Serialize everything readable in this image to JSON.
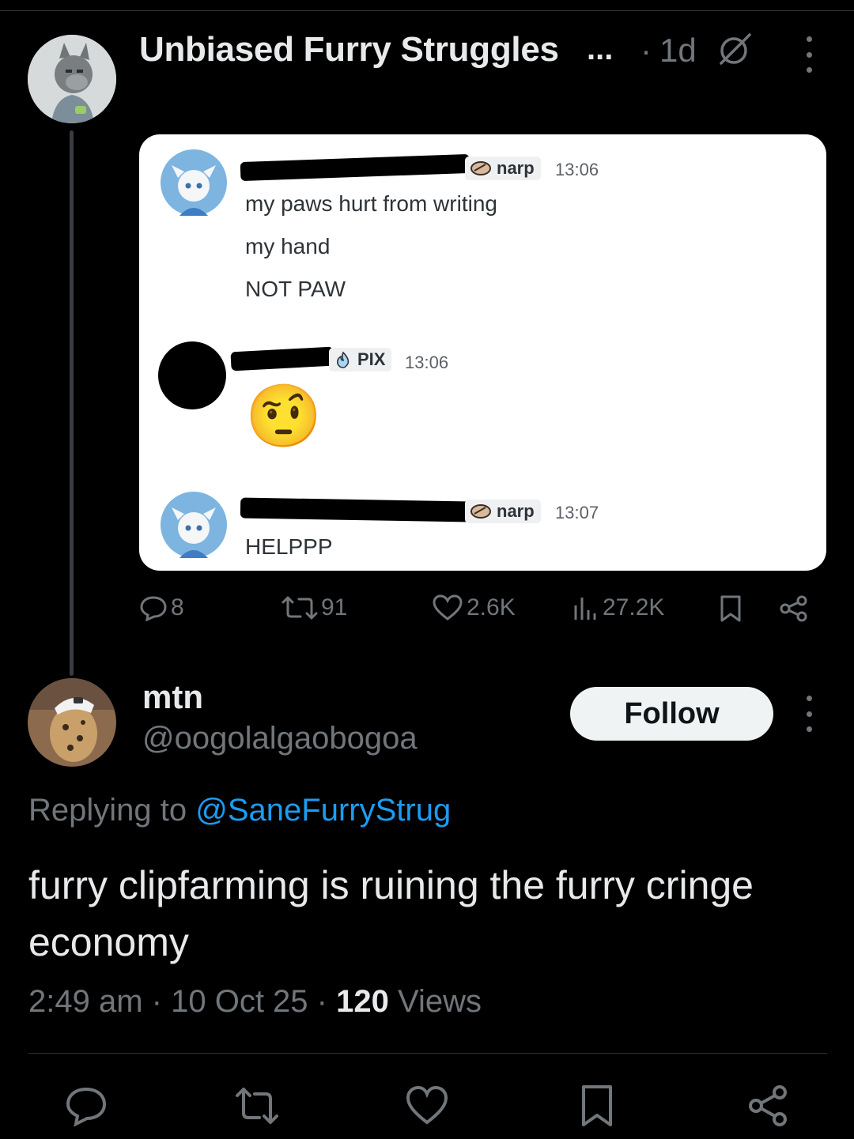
{
  "parent_post": {
    "author_name": "Unbiased Furry Struggles",
    "truncation": "...",
    "separator": "·",
    "time_ago": "1d",
    "screenshot": {
      "messages": [
        {
          "role": "narp",
          "time": "13:06",
          "lines": [
            "my paws hurt from writing",
            "my hand",
            "NOT PAW"
          ]
        },
        {
          "role": "PIX",
          "time": "13:06",
          "emoji": "🤨"
        },
        {
          "role": "narp",
          "time": "13:07",
          "lines": [
            "HELPPP"
          ]
        }
      ]
    },
    "stats": {
      "replies": "8",
      "reposts": "91",
      "likes": "2.6K",
      "views": "27.2K"
    }
  },
  "reply": {
    "display_name": "mtn",
    "handle": "@oogolalgaobogoa",
    "follow_label": "Follow",
    "replying_prefix": "Replying to",
    "replying_to": "@SaneFurryStrug",
    "text": "furry clipfarming is ruining the furry cringe economy",
    "time": "2:49 am",
    "date": "10 Oct 25",
    "view_count": "120",
    "views_label": "Views",
    "separator": "·"
  },
  "colors": {
    "background": "#000000",
    "muted": "#71767b",
    "link": "#1d9bf0",
    "text": "#e7e9ea"
  },
  "icons": [
    "more-icon",
    "no-entry-icon",
    "reply-icon",
    "repost-icon",
    "like-icon",
    "views-icon",
    "bookmark-icon",
    "share-icon"
  ]
}
